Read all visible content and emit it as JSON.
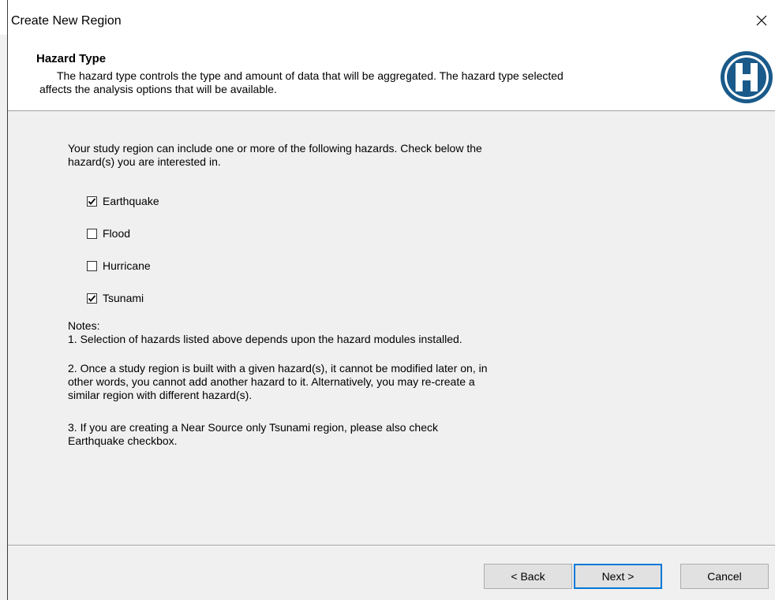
{
  "window": {
    "title": "Create New Region"
  },
  "header": {
    "title": "Hazard Type",
    "desc_line1": "The hazard type controls the type and amount of data that will be aggregated.  The hazard type selected",
    "desc_line2": "affects the analysis options that will be available.",
    "logo_icon": "hazus-h-logo",
    "logo_color": "#1a5a8a"
  },
  "content": {
    "intro_line1": "Your study region can include one or more of the following hazards. Check below the",
    "intro_line2": "hazard(s) you are interested in.",
    "hazards": [
      {
        "label": "Earthquake",
        "checked": true
      },
      {
        "label": "Flood",
        "checked": false
      },
      {
        "label": "Hurricane",
        "checked": false
      },
      {
        "label": "Tsunami",
        "checked": true
      }
    ],
    "notes": {
      "heading": "Notes:",
      "note1": "1. Selection of hazards listed above depends upon the hazard modules installed.",
      "note2_line1": "2. Once a study region is built with a given hazard(s), it cannot be modified later on, in",
      "note2_line2": "other words, you cannot add another hazard to it. Alternatively, you may re-create a",
      "note2_line3": "similar region with different hazard(s).",
      "note3_line1": "3. If you are creating a Near Source only Tsunami region, please also check",
      "note3_line2": "Earthquake checkbox."
    }
  },
  "buttons": {
    "back": "< Back",
    "next": "Next >",
    "cancel": "Cancel"
  },
  "colors": {
    "default_button_border": "#0078d7",
    "dialog_background": "#f0f0f0"
  }
}
